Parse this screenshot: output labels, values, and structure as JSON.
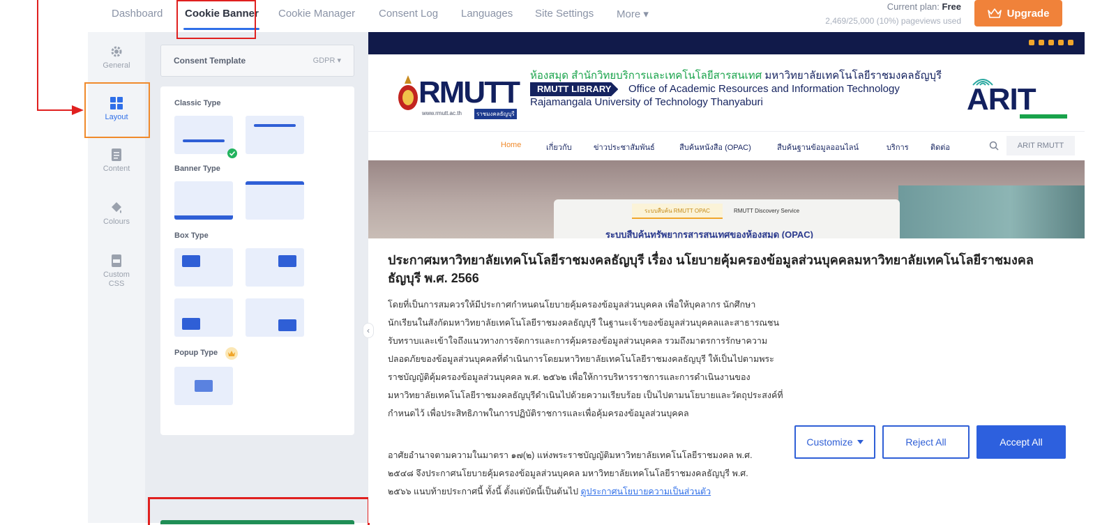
{
  "top_nav": {
    "items": [
      "Dashboard",
      "Cookie Banner",
      "Cookie Manager",
      "Consent Log",
      "Languages",
      "Site Settings",
      "More ▾"
    ],
    "active_index": 1
  },
  "plan": {
    "label": "Current plan:",
    "value": "Free",
    "usage": "2,469/25,000 (10%) pageviews used",
    "upgrade_label": "Upgrade"
  },
  "rail": {
    "items": [
      {
        "label": "General",
        "icon": "gear-icon"
      },
      {
        "label": "Layout",
        "icon": "layout-grid-icon"
      },
      {
        "label": "Content",
        "icon": "document-icon"
      },
      {
        "label": "Colours",
        "icon": "paint-bucket-icon"
      },
      {
        "label": "Custom CSS",
        "icon": "css-file-icon"
      }
    ],
    "active_index": 1
  },
  "panel": {
    "template_label": "Consent Template",
    "template_value": "GDPR ▾",
    "sections": [
      "Classic Type",
      "Banner Type",
      "Box Type",
      "Popup Type"
    ]
  },
  "preview": {
    "site": {
      "brand": "RMUTT",
      "brand_url": "www.rmutt.ac.th",
      "brand_tag": "ราชมงคลธัญบุรี",
      "title_green": "ห้องสมุด สำนักวิทยบริการและเทคโนโลยีสารสนเทศ",
      "title_blue": " มหาวิทยาลัยเทคโนโลยีราชมงคลธัญบุรี",
      "badge": "RMUTT LIBRARY",
      "office": "Office of Academic Resources and Information Technology",
      "university": "Rajamangala University of Technology Thanyaburi",
      "arit": "ARIT",
      "menu": [
        "Home",
        "เกี่ยวกับ",
        "ข่าวประชาสัมพันธ์",
        "สืบค้นหนังสือ (OPAC)",
        "สืบค้นฐานข้อมูลออนไลน์",
        "บริการ",
        "ติดต่อ"
      ],
      "search_label": "ARIT RMUTT",
      "hero_tab1": "ระบบสืบค้น RMUTT OPAC",
      "hero_tab2": "RMUTT Discovery Service",
      "hero_sub": "ระบบสืบค้นทรัพยากรสารสนเทศของห้องสมุด (OPAC)"
    },
    "banner": {
      "title": "ประกาศมหาวิทยาลัยเทคโนโลยีราชมงคลธัญบุรี เรื่อง นโยบายคุ้มครองข้อมูลส่วนบุคคลมหาวิทยาลัยเทคโนโลยีราชมงคลธัญบุรี พ.ศ. 2566",
      "body1": "โดยที่เป็นการสมควรให้มีประกาศกำหนดนโยบายคุ้มครองข้อมูลส่วนบุคคล เพื่อให้บุคลากร นักศึกษา นักเรียนในสังกัดมหาวิทยาลัยเทคโนโลยีราชมงคลธัญบุรี ในฐานะเจ้าของข้อมูลส่วนบุคคลและสาธารณชนรับทราบและเข้าใจถึงแนวทางการจัดการและการคุ้มครองข้อมูลส่วนบุคคล รวมถึงมาตรการรักษาความปลอดภัยของข้อมูลส่วนบุคคลที่ดำเนินการโดยมหาวิทยาลัยเทคโนโลยีราชมงคลธัญบุรี ให้เป็นไปตามพระราชบัญญัติคุ้มครองข้อมูลส่วนบุคคล พ.ศ. ๒๕๖๒ เพื่อให้การบริหารราชการและการดำเนินงานของมหาวิทยาลัยเทคโนโลยีราชมงคลธัญบุรีดำเนินไปด้วยความเรียบร้อย เป็นไปตามนโยบายและวัตถุประสงค์ที่กำหนดไว้ เพื่อประสิทธิภาพในการปฏิบัติราชการและเพื่อคุ้มครองข้อมูลส่วนบุคคล",
      "body2": "อาศัยอำนาจตามความในมาตรา ๑๗(๒) แห่งพระราชบัญญัติมหาวิทยาลัยเทคโนโลยีราชมงคล พ.ศ. ๒๕๔๘ จึงประกาศนโยบายคุ้มครองข้อมูลส่วนบุคคล มหาวิทยาลัยเทคโนโลยีราชมงคลธัญบุรี พ.ศ. ๒๕๖๖ แนบท้ายประกาศนี้ ทั้งนี้ ตั้งแต่บัดนี้เป็นต้นไป",
      "link": "ดูประกาศนโยบายความเป็นส่วนตัว",
      "customize": "Customize",
      "reject": "Reject All",
      "accept": "Accept All"
    }
  },
  "colors": {
    "accent": "#2f6fe8",
    "upgrade": "#f0823a",
    "annotation": "#e0201f",
    "site_navy": "#111a4a"
  }
}
